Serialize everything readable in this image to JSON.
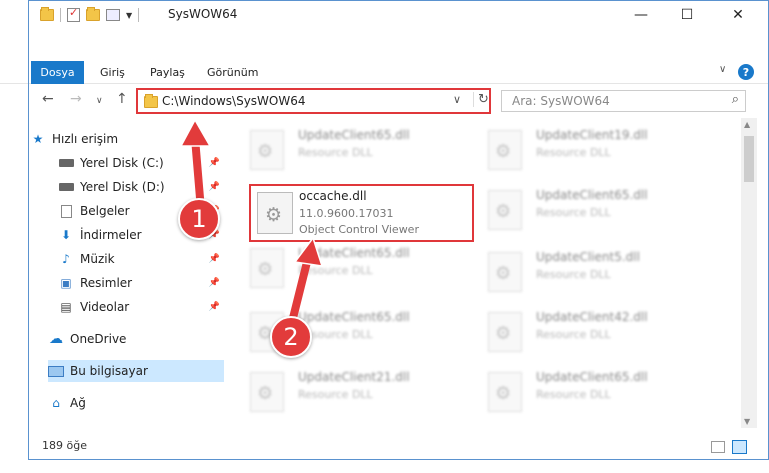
{
  "window": {
    "title": "SysWOW64",
    "min": "—",
    "max": "☐",
    "close": "✕"
  },
  "ribbon": {
    "tabs": [
      "Dosya",
      "Giriş",
      "Paylaş",
      "Görünüm"
    ],
    "expand": "∨",
    "help": "?"
  },
  "nav": {
    "back": "←",
    "forward": "→",
    "recent": "∨",
    "up": "↑"
  },
  "address": {
    "path": "C:\\Windows\\SysWOW64",
    "dropdown": "∨",
    "refresh": "↻"
  },
  "search": {
    "placeholder": "Ara: SysWOW64",
    "icon": "⌕"
  },
  "sidebar": {
    "items": [
      {
        "label": "Hızlı erişim",
        "icon": "★"
      },
      {
        "label": "Yerel Disk (C:)",
        "icon": "drive"
      },
      {
        "label": "Yerel Disk (D:)",
        "icon": "drive"
      },
      {
        "label": "Belgeler",
        "icon": "doc"
      },
      {
        "label": "İndirmeler",
        "icon": "⬇"
      },
      {
        "label": "Müzik",
        "icon": "♪"
      },
      {
        "label": "Resimler",
        "icon": "▣"
      },
      {
        "label": "Videolar",
        "icon": "▤"
      },
      {
        "label": "OneDrive",
        "icon": "☁"
      },
      {
        "label": "Bu bilgisayar",
        "icon": "pc"
      },
      {
        "label": "Ağ",
        "icon": "⌂"
      }
    ],
    "pin": "📌"
  },
  "files": {
    "highlighted": {
      "name": "occache.dll",
      "version": "11.0.9600.17031",
      "description": "Object Control Viewer"
    },
    "left": [
      {
        "name": "UpdateClient65.dll",
        "type": "Resource DLL"
      },
      {
        "name": "UpdateClient65.dll",
        "type": "Resource DLL"
      },
      {
        "name": "UpdateClient65.dll",
        "type": "Resource DLL"
      },
      {
        "name": "UpdateClient21.dll",
        "type": "Resource DLL"
      }
    ],
    "right": [
      {
        "name": "UpdateClient19.dll",
        "type": "Resource DLL"
      },
      {
        "name": "UpdateClient65.dll",
        "type": "Resource DLL"
      },
      {
        "name": "UpdateClient5.dll",
        "type": "Resource DLL"
      },
      {
        "name": "UpdateClient42.dll",
        "type": "Resource DLL"
      },
      {
        "name": "UpdateClient65.dll",
        "type": "Resource DLL"
      }
    ]
  },
  "status": {
    "count": "189 öğe"
  },
  "annotations": {
    "step1": "1",
    "step2": "2"
  },
  "colors": {
    "accent": "#1979ca",
    "highlight": "#e0373a",
    "selected": "#cce8ff"
  }
}
